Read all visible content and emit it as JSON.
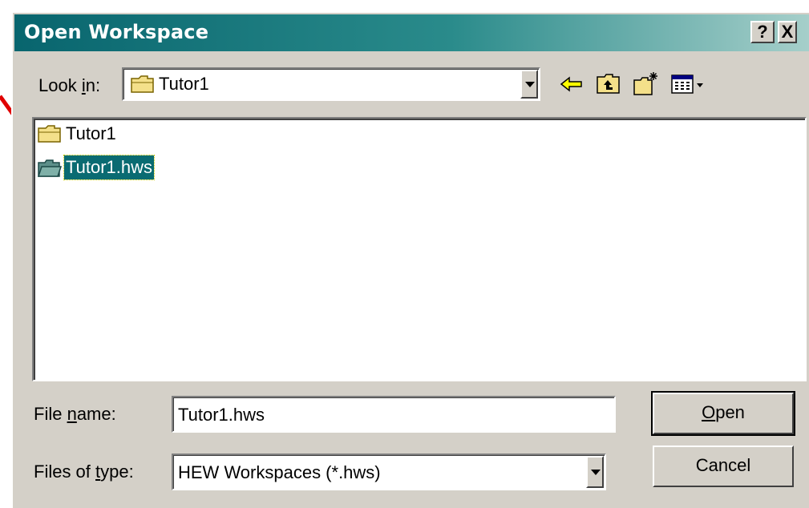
{
  "window": {
    "title": "Open Workspace",
    "help_label": "?",
    "close_label": "X"
  },
  "look_in": {
    "label_pre": "Look ",
    "label_key": "i",
    "label_post": "n:",
    "value": "Tutor1",
    "value_icon": "folder-icon"
  },
  "toolbar": {
    "back_icon": "back-arrow-icon",
    "up_icon": "up-one-level-icon",
    "new_folder_icon": "new-folder-icon",
    "view_menu_icon": "view-menu-icon"
  },
  "files": [
    {
      "name": "Tutor1",
      "icon": "folder-icon",
      "selected": false
    },
    {
      "name": "Tutor1.hws",
      "icon": "workspace-file-icon",
      "selected": true
    }
  ],
  "file_name": {
    "label_pre": "File ",
    "label_key": "n",
    "label_post": "ame:",
    "value": "Tutor1.hws"
  },
  "file_type": {
    "label_pre": "Files of ",
    "label_key": "t",
    "label_post": "ype:",
    "value": "HEW Workspaces (*.hws)"
  },
  "buttons": {
    "open_key": "O",
    "open_rest": "pen",
    "cancel": "Cancel"
  },
  "colors": {
    "title_start": "#08656e",
    "selection": "#0a6b72",
    "annotation_arrow": "#e00000"
  }
}
